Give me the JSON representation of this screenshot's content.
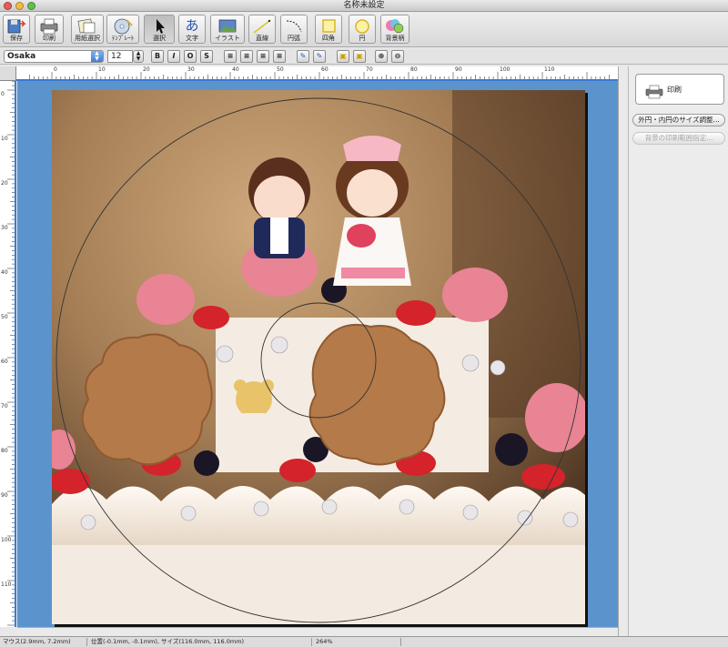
{
  "window": {
    "title": "名称未設定"
  },
  "toolbar": {
    "buttons": [
      {
        "label": "保存",
        "icon": "save-icon"
      },
      {
        "label": "印刷",
        "icon": "printer-icon"
      },
      {
        "label": "用紙選択",
        "icon": "paper-select-icon"
      },
      {
        "label": "ﾃﾝﾌﾟﾚｰﾄ",
        "icon": "template-icon"
      },
      {
        "label": "選択",
        "icon": "arrow-pointer-icon",
        "active": true
      },
      {
        "label": "文字",
        "icon": "text-icon",
        "glyph": "あ"
      },
      {
        "label": "イラスト",
        "icon": "illustration-icon"
      },
      {
        "label": "直線",
        "icon": "line-icon"
      },
      {
        "label": "円弧",
        "icon": "arc-icon"
      },
      {
        "label": "四角",
        "icon": "rectangle-icon"
      },
      {
        "label": "円",
        "icon": "circle-icon"
      },
      {
        "label": "背景柄",
        "icon": "background-pattern-icon"
      }
    ]
  },
  "format": {
    "font": "Osaka",
    "size": "12",
    "bold": "B",
    "italic": "I",
    "outline": "O",
    "shadow": "S"
  },
  "ruler": {
    "top_ticks": [
      "0",
      "10",
      "20",
      "30",
      "40",
      "50",
      "60",
      "70",
      "80",
      "90",
      "100",
      "110"
    ],
    "left_ticks": [
      "0",
      "10",
      "20",
      "30",
      "40",
      "50",
      "60",
      "70",
      "80",
      "90",
      "100",
      "110"
    ]
  },
  "sidepanel": {
    "print_label": "印刷",
    "resize_circle": "外円・内円のサイズ調整...",
    "bg_print_range": "背景の印刷範囲指定..."
  },
  "status": {
    "mouse": "マウス(2.9mm, 7.2mm)",
    "position": "位置(-0.1mm, -0.1mm), サイズ(116.0mm, 116.0mm)",
    "zoom": "264%"
  },
  "colors": {
    "canvas_bg": "#5b94cd",
    "ruler_accent": "#3a7bd5"
  }
}
